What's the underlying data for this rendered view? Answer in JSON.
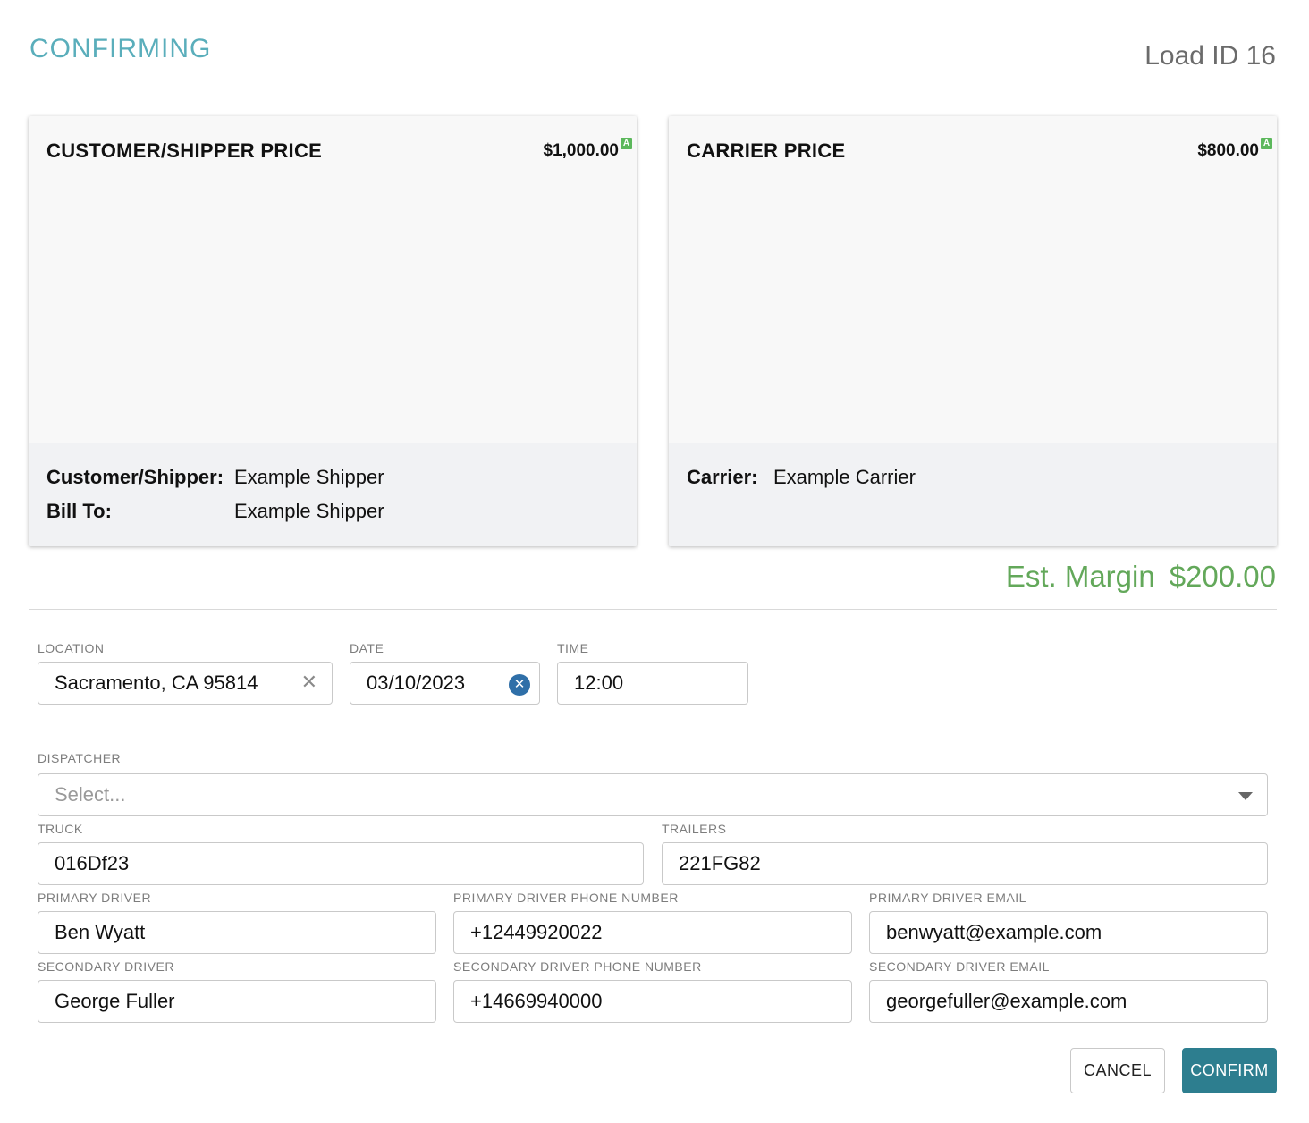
{
  "header": {
    "title": "CONFIRMING",
    "load_id": "Load ID 16"
  },
  "customer_card": {
    "title": "CUSTOMER/SHIPPER PRICE",
    "price": "$1,000.00",
    "badge": "A",
    "customer_label": "Customer/Shipper:",
    "customer_value": "Example Shipper",
    "bill_to_label": "Bill To:",
    "bill_to_value": "Example Shipper"
  },
  "carrier_card": {
    "title": "CARRIER PRICE",
    "price": "$800.00",
    "badge": "A",
    "carrier_label": "Carrier:",
    "carrier_value": "Example Carrier"
  },
  "margin": {
    "label": "Est. Margin",
    "value": "$200.00"
  },
  "form": {
    "location": {
      "label": "LOCATION",
      "value": "Sacramento, CA 95814",
      "clear_icon": "✕"
    },
    "date": {
      "label": "DATE",
      "value": "03/10/2023",
      "clear_icon": "✕"
    },
    "time": {
      "label": "TIME",
      "value": "12:00"
    },
    "dispatcher": {
      "label": "DISPATCHER",
      "placeholder": "Select..."
    },
    "truck": {
      "label": "TRUCK",
      "value": "016Df23"
    },
    "trailers": {
      "label": "TRAILERS",
      "value": "221FG82"
    },
    "primary_driver": {
      "label": "PRIMARY DRIVER",
      "value": "Ben Wyatt"
    },
    "primary_phone": {
      "label": "PRIMARY DRIVER PHONE NUMBER",
      "value": "+12449920022"
    },
    "primary_email": {
      "label": "PRIMARY DRIVER EMAIL",
      "value": "benwyatt@example.com"
    },
    "secondary_driver": {
      "label": "SECONDARY DRIVER",
      "value": "George Fuller"
    },
    "secondary_phone": {
      "label": "SECONDARY DRIVER PHONE NUMBER",
      "value": "+14669940000"
    },
    "secondary_email": {
      "label": "SECONDARY DRIVER EMAIL",
      "value": "georgefuller@example.com"
    }
  },
  "actions": {
    "cancel_label": "CANCEL",
    "confirm_label": "CONFIRM"
  },
  "colors": {
    "title": "#5aaebb",
    "margin": "#63a85a",
    "confirm_button": "#2d7e8f",
    "badge": "#5cb85c"
  }
}
